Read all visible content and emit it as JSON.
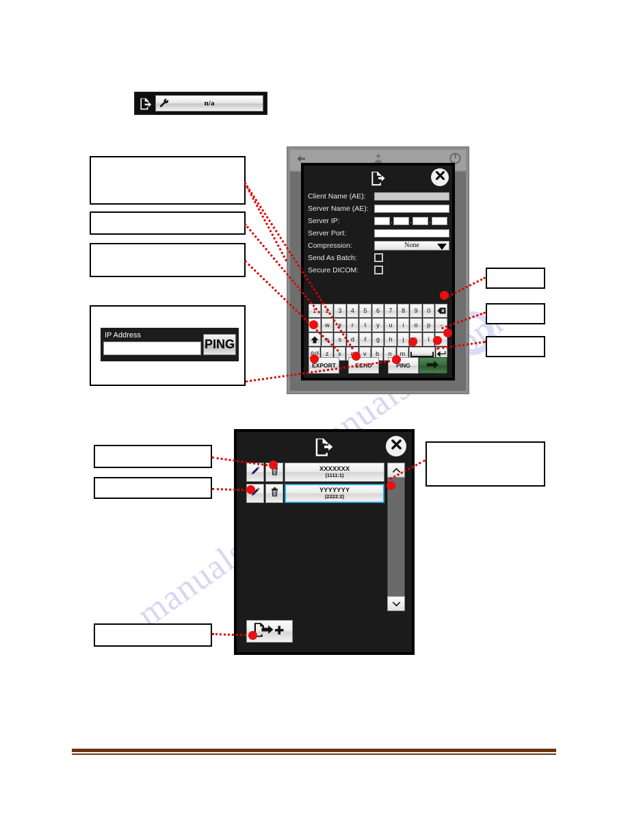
{
  "document": {
    "watermarks": [
      "manualslib.com",
      "manualslib.com"
    ]
  },
  "top_widget": {
    "export_icon": "document-export-icon",
    "wrench_icon": "wrench-icon",
    "value": "n/a"
  },
  "tablet_frame": {
    "back_icon": "back-arrow-icon",
    "user_icon": "person-icon",
    "power_icon": "power-icon"
  },
  "settings_dialog": {
    "title_icon": "document-export-icon",
    "close_icon": "close-icon",
    "fields": [
      {
        "label": "Client Name (AE):",
        "type": "text",
        "value": "",
        "disabled": true
      },
      {
        "label": "Server Name (AE):",
        "type": "text",
        "value": "",
        "disabled": false
      },
      {
        "label": "Server IP:",
        "type": "ip",
        "segments": [
          "",
          "",
          "",
          ""
        ],
        "separator": "."
      },
      {
        "label": "Server Port:",
        "type": "text",
        "value": "",
        "disabled": false
      },
      {
        "label": "Compression:",
        "type": "select",
        "value": "None"
      },
      {
        "label": "Send As Batch:",
        "type": "checkbox",
        "checked": false
      },
      {
        "label": "Secure DICOM:",
        "type": "checkbox",
        "checked": false
      }
    ],
    "keyboard": {
      "rows": [
        [
          "1",
          "2",
          "3",
          "4",
          "5",
          "6",
          "7",
          "8",
          "9",
          "0",
          "backspace-key"
        ],
        [
          "q",
          "w",
          "e",
          "r",
          "t",
          "y",
          "u",
          "i",
          "o",
          "p",
          "-"
        ],
        [
          "shift-key",
          "a",
          "s",
          "d",
          "f",
          "g",
          "h",
          "j",
          "k",
          "l",
          "."
        ],
        [
          "@#$",
          "z",
          "x",
          "c",
          "v",
          "b",
          "n",
          "m",
          "space-key",
          "enter-key"
        ]
      ]
    },
    "actions": {
      "export_label": "EXPORT",
      "echo_label": "ECHO",
      "ping_label": "PING",
      "go_icon": "right-arrow-icon"
    }
  },
  "ip_panel": {
    "label": "IP Address",
    "value": "",
    "ping_label": "PING"
  },
  "list_dialog": {
    "title_icon": "document-export-icon",
    "close_icon": "close-icon",
    "edit_icon": "pencil-icon",
    "delete_icon": "trash-icon",
    "scroll_up_icon": "chevron-up-icon",
    "scroll_down_icon": "chevron-down-icon",
    "add_icon": "add-destination-icon",
    "entries": [
      {
        "name": "XXXXXXX",
        "address": "(1111:1)",
        "selected": false
      },
      {
        "name": "YYYYYYY",
        "address": "(2222:2)",
        "selected": true
      }
    ]
  },
  "callouts": {
    "upper_left": [
      "",
      "",
      ""
    ],
    "ip_panel_box": "",
    "upper_right": [
      "",
      "",
      ""
    ],
    "lower_left": [
      "",
      ""
    ],
    "lower_right": [
      ""
    ],
    "add_box": ""
  },
  "colors": {
    "leader": "#e00000",
    "accent_selected": "#29a7e0",
    "dialog_bg": "#1b1b1b",
    "footer_rule": "#6b3410",
    "go_button": "#3a7040"
  }
}
